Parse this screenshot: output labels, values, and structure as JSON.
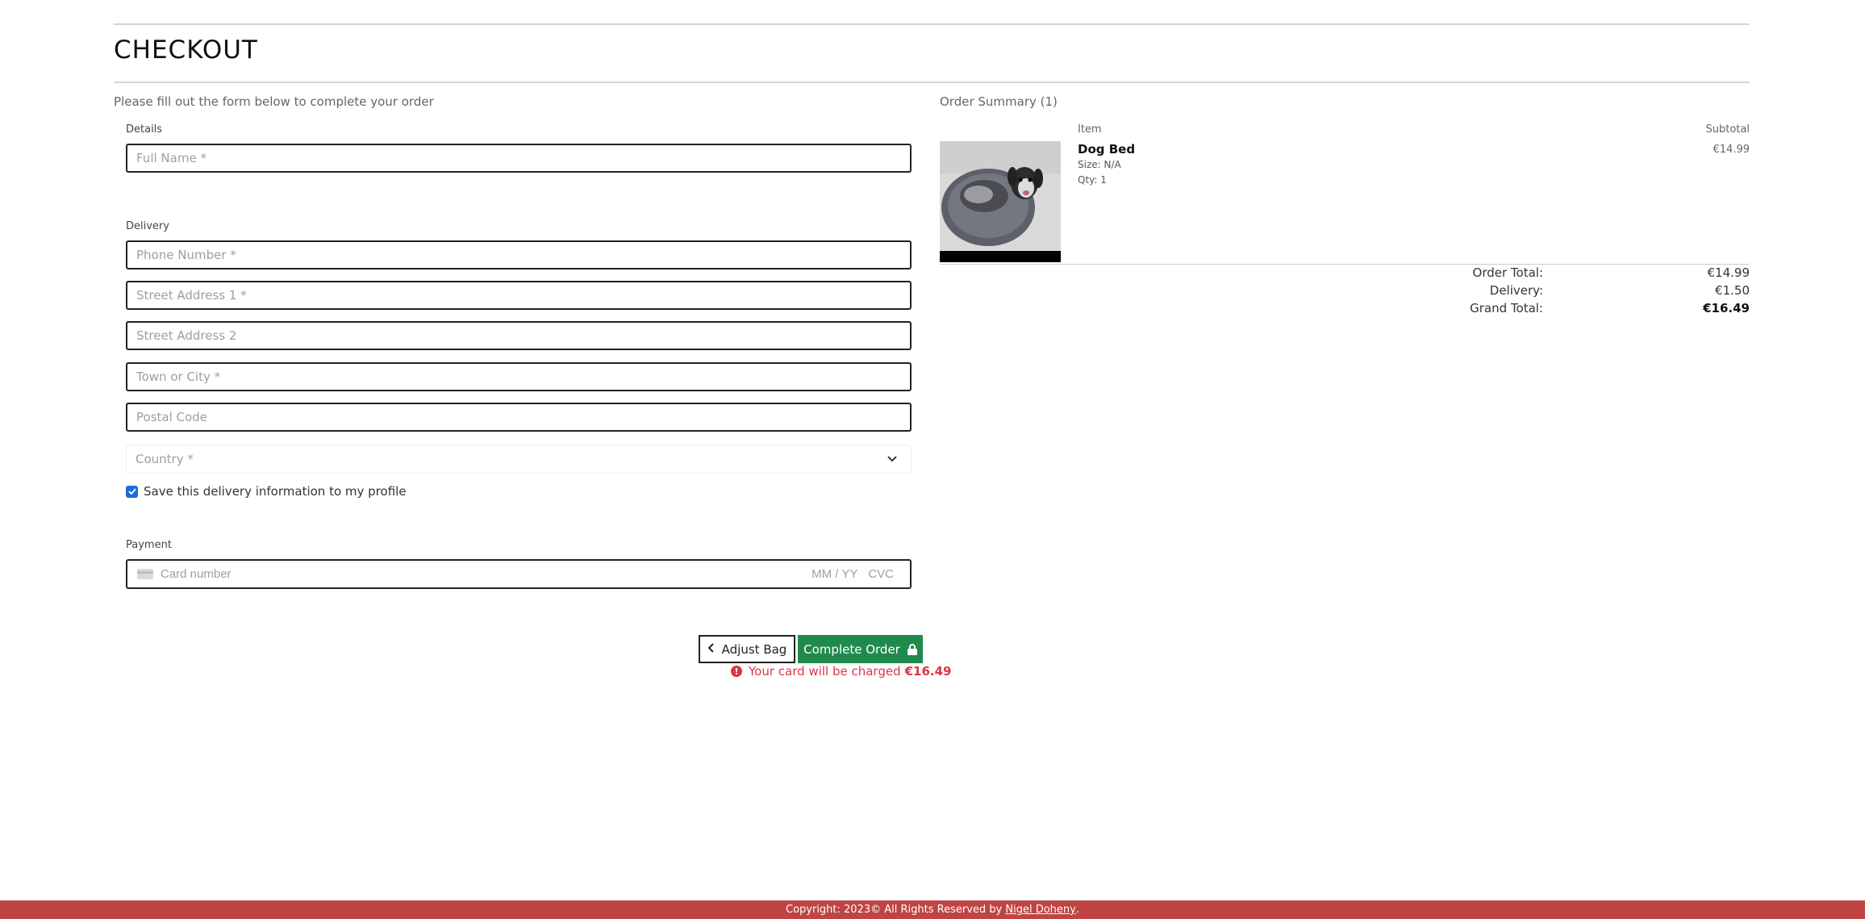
{
  "page": {
    "title": "CHECKOUT",
    "intro": "Please fill out the form below to complete your order"
  },
  "form": {
    "details_label": "Details",
    "full_name_placeholder": "Full Name *",
    "delivery_label": "Delivery",
    "phone_placeholder": "Phone Number *",
    "street1_placeholder": "Street Address 1 *",
    "street2_placeholder": "Street Address 2",
    "town_placeholder": "Town or City *",
    "postal_placeholder": "Postal Code",
    "country_placeholder": "Country *",
    "save_info_label": "Save this delivery information to my profile",
    "save_info_checked": true,
    "payment_label": "Payment",
    "card_number_placeholder": "Card number",
    "card_expiry_placeholder": "MM / YY",
    "card_cvc_placeholder": "CVC"
  },
  "actions": {
    "adjust_label": "Adjust Bag",
    "complete_label": "Complete Order",
    "charge_text": "Your card will be charged",
    "charge_amount": "€16.49"
  },
  "summary": {
    "heading": "Order Summary (1)",
    "item_col": "Item",
    "subtotal_col": "Subtotal",
    "items": [
      {
        "name": "Dog Bed",
        "size": "Size: N/A",
        "qty": "Qty: 1",
        "subtotal": "€14.99"
      }
    ],
    "order_total_label": "Order Total:",
    "order_total": "€14.99",
    "delivery_label": "Delivery:",
    "delivery": "€1.50",
    "grand_total_label": "Grand Total:",
    "grand_total": "€16.49"
  },
  "footer": {
    "text": "Copyright: 2023© All Rights Reserved by",
    "author": "Nigel Doheny",
    "suffix": "."
  },
  "colors": {
    "primary_green": "#1f8a4c",
    "error_red": "#dc3545",
    "footer_red": "#bf4444",
    "checkbox_blue": "#1a6ddb"
  }
}
